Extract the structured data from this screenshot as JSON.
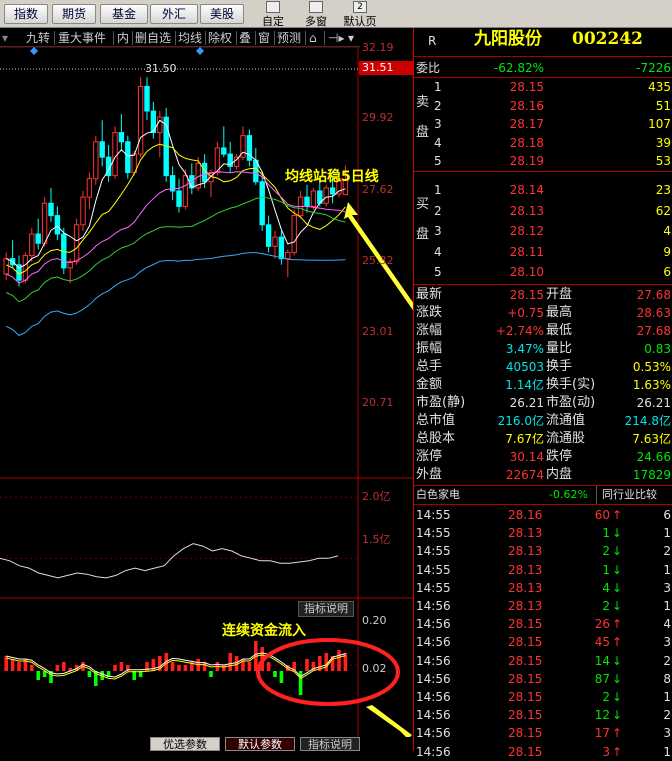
{
  "topbar": {
    "tabs": [
      "指数",
      "期货",
      "基金",
      "外汇",
      "美股"
    ],
    "right": [
      "自定",
      "多窗",
      "默认页"
    ],
    "badge": "2"
  },
  "toolbar": {
    "items": [
      "九转",
      "重大事件",
      "内",
      "删自选",
      "均线",
      "除权",
      "叠",
      "窗",
      "预测"
    ],
    "arrows": [
      "⊣▸",
      "▾"
    ]
  },
  "annotations": {
    "main": "均线站稳5日线",
    "flow": "连续资金流入"
  },
  "axis": {
    "price": [
      "32.19",
      "31.51",
      "29.92",
      "27.62",
      "25.32",
      "23.01",
      "20.71"
    ],
    "volume": [
      "2.0亿",
      "1.5亿"
    ],
    "flow": [
      "0.20",
      "0.02"
    ],
    "high_marker": "31.50"
  },
  "flow_panel": {
    "label": "指标说明"
  },
  "bottom_tabs": [
    "优选参数",
    "默认参数",
    "指标说明"
  ],
  "quote": {
    "r_label": "R",
    "name": "九阳股份",
    "code": "002242",
    "wei_label": "委比",
    "wei_ratio": "-62.82%",
    "wei_diff": "-7226",
    "sell_label": "卖盘",
    "buy_label": "买盘",
    "sell": [
      {
        "lv": "5",
        "price": "28.19",
        "vol": "53"
      },
      {
        "lv": "4",
        "price": "28.18",
        "vol": "39"
      },
      {
        "lv": "3",
        "price": "28.17",
        "vol": "107"
      },
      {
        "lv": "2",
        "price": "28.16",
        "vol": "51"
      },
      {
        "lv": "1",
        "price": "28.15",
        "vol": "435"
      }
    ],
    "buy": [
      {
        "lv": "1",
        "price": "28.14",
        "vol": "23"
      },
      {
        "lv": "2",
        "price": "28.13",
        "vol": "62"
      },
      {
        "lv": "3",
        "price": "28.12",
        "vol": "4"
      },
      {
        "lv": "4",
        "price": "28.11",
        "vol": "9"
      },
      {
        "lv": "5",
        "price": "28.10",
        "vol": "6"
      }
    ],
    "stats": [
      {
        "l1": "最新",
        "v1": "28.15",
        "c1": "red",
        "l2": "开盘",
        "v2": "27.68",
        "c2": "red"
      },
      {
        "l1": "涨跌",
        "v1": "+0.75",
        "c1": "red",
        "l2": "最高",
        "v2": "28.63",
        "c2": "red"
      },
      {
        "l1": "涨幅",
        "v1": "+2.74%",
        "c1": "red",
        "l2": "最低",
        "v2": "27.68",
        "c2": "red"
      },
      {
        "l1": "振幅",
        "v1": "3.47%",
        "c1": "cyan",
        "l2": "量比",
        "v2": "0.83",
        "c2": "grn"
      },
      {
        "l1": "总手",
        "v1": "40503",
        "c1": "cyan",
        "l2": "换手",
        "v2": "0.53%",
        "c2": "yel"
      },
      {
        "l1": "金额",
        "v1": "1.14亿",
        "c1": "cyan",
        "l2": "换手(实)",
        "v2": "1.63%",
        "c2": "yel"
      },
      {
        "l1": "市盈(静)",
        "v1": "26.21",
        "c1": "wht",
        "l2": "市盈(动)",
        "v2": "26.21",
        "c2": "wht"
      },
      {
        "l1": "总市值",
        "v1": "216.0亿",
        "c1": "cyan",
        "l2": "流通值",
        "v2": "214.8亿",
        "c2": "cyan"
      },
      {
        "l1": "总股本",
        "v1": "7.67亿",
        "c1": "yel",
        "l2": "流通股",
        "v2": "7.63亿",
        "c2": "yel"
      },
      {
        "l1": "涨停",
        "v1": "30.14",
        "c1": "red",
        "l2": "跌停",
        "v2": "24.66",
        "c2": "grn"
      },
      {
        "l1": "外盘",
        "v1": "22674",
        "c1": "red",
        "l2": "内盘",
        "v2": "17829",
        "c2": "grn"
      }
    ],
    "sector": "白色家电",
    "sector_chg": "-0.62%",
    "compare": "同行业比较",
    "ticks": [
      {
        "t": "14:55",
        "p": "28.16",
        "v": "60",
        "d": "up",
        "n": "6"
      },
      {
        "t": "14:55",
        "p": "28.13",
        "v": "1",
        "d": "dn",
        "n": "1"
      },
      {
        "t": "14:55",
        "p": "28.13",
        "v": "2",
        "d": "dn",
        "n": "2"
      },
      {
        "t": "14:55",
        "p": "28.13",
        "v": "1",
        "d": "dn",
        "n": "1"
      },
      {
        "t": "14:55",
        "p": "28.13",
        "v": "4",
        "d": "dn",
        "n": "3"
      },
      {
        "t": "14:56",
        "p": "28.13",
        "v": "2",
        "d": "dn",
        "n": "1"
      },
      {
        "t": "14:56",
        "p": "28.15",
        "v": "26",
        "d": "up",
        "n": "4"
      },
      {
        "t": "14:56",
        "p": "28.15",
        "v": "45",
        "d": "up",
        "n": "3"
      },
      {
        "t": "14:56",
        "p": "28.15",
        "v": "14",
        "d": "dn",
        "n": "2"
      },
      {
        "t": "14:56",
        "p": "28.15",
        "v": "87",
        "d": "dn",
        "n": "8"
      },
      {
        "t": "14:56",
        "p": "28.15",
        "v": "2",
        "d": "dn",
        "n": "1"
      },
      {
        "t": "14:56",
        "p": "28.15",
        "v": "12",
        "d": "dn",
        "n": "2"
      },
      {
        "t": "14:56",
        "p": "28.15",
        "v": "17",
        "d": "up",
        "n": "3"
      },
      {
        "t": "14:56",
        "p": "28.15",
        "v": "3",
        "d": "up",
        "n": "1"
      }
    ]
  },
  "chart_data": [
    {
      "type": "candlestick",
      "ylim": [
        20.71,
        32.19
      ],
      "high_marker": 31.5,
      "candles": [
        [
          25.1,
          25.8,
          24.9,
          25.6
        ],
        [
          25.6,
          26.2,
          25.3,
          25.4
        ],
        [
          25.4,
          25.7,
          24.7,
          24.9
        ],
        [
          24.9,
          25.8,
          24.8,
          25.7
        ],
        [
          25.7,
          26.6,
          25.5,
          26.4
        ],
        [
          26.4,
          26.9,
          25.9,
          26.1
        ],
        [
          26.1,
          27.6,
          26.0,
          27.4
        ],
        [
          27.4,
          27.9,
          26.8,
          27.0
        ],
        [
          27.0,
          27.3,
          26.2,
          26.4
        ],
        [
          26.4,
          26.6,
          25.1,
          25.3
        ],
        [
          25.3,
          25.6,
          24.8,
          25.5
        ],
        [
          25.5,
          26.9,
          25.4,
          26.7
        ],
        [
          26.7,
          27.8,
          26.5,
          27.6
        ],
        [
          27.6,
          28.4,
          27.2,
          28.2
        ],
        [
          28.2,
          29.6,
          28.0,
          29.4
        ],
        [
          29.4,
          30.1,
          28.6,
          28.9
        ],
        [
          28.9,
          29.3,
          28.1,
          28.3
        ],
        [
          28.3,
          29.9,
          28.2,
          29.7
        ],
        [
          29.7,
          30.3,
          29.1,
          29.4
        ],
        [
          29.4,
          29.6,
          28.2,
          28.4
        ],
        [
          28.4,
          29.1,
          28.3,
          29.0
        ],
        [
          29.0,
          31.5,
          28.9,
          31.2
        ],
        [
          31.2,
          31.5,
          30.1,
          30.4
        ],
        [
          30.4,
          30.7,
          29.5,
          29.7
        ],
        [
          29.7,
          30.4,
          28.9,
          30.2
        ],
        [
          30.2,
          30.5,
          28.1,
          28.3
        ],
        [
          28.3,
          28.6,
          27.5,
          27.8
        ],
        [
          27.8,
          28.2,
          27.1,
          27.3
        ],
        [
          27.3,
          28.5,
          27.2,
          28.3
        ],
        [
          28.3,
          28.7,
          27.7,
          27.9
        ],
        [
          27.9,
          28.9,
          27.8,
          28.7
        ],
        [
          28.7,
          29.0,
          27.9,
          28.1
        ],
        [
          28.1,
          28.5,
          27.6,
          28.4
        ],
        [
          28.4,
          29.4,
          28.3,
          29.2
        ],
        [
          29.2,
          29.9,
          28.9,
          29.0
        ],
        [
          29.0,
          29.4,
          28.4,
          28.6
        ],
        [
          28.6,
          29.0,
          28.5,
          28.9
        ],
        [
          28.9,
          29.9,
          28.8,
          29.6
        ],
        [
          29.6,
          29.8,
          28.6,
          28.8
        ],
        [
          28.8,
          29.2,
          28.0,
          28.1
        ],
        [
          28.1,
          28.4,
          26.5,
          26.7
        ],
        [
          26.7,
          27.0,
          25.8,
          26.0
        ],
        [
          26.0,
          26.5,
          25.6,
          26.3
        ],
        [
          26.3,
          26.5,
          25.4,
          25.6
        ],
        [
          25.6,
          25.9,
          25.0,
          25.8
        ],
        [
          25.8,
          27.2,
          25.7,
          27.0
        ],
        [
          27.0,
          27.8,
          26.9,
          27.6
        ],
        [
          27.6,
          28.0,
          27.1,
          27.3
        ],
        [
          27.3,
          27.9,
          27.2,
          27.8
        ],
        [
          27.8,
          28.2,
          27.3,
          27.4
        ],
        [
          27.4,
          28.0,
          27.3,
          27.9
        ],
        [
          27.9,
          28.3,
          27.4,
          27.7
        ],
        [
          27.7,
          28.3,
          27.6,
          28.2
        ],
        [
          27.68,
          28.63,
          27.68,
          28.15
        ]
      ]
    },
    {
      "type": "line",
      "ylim": [
        1.2,
        2.1
      ],
      "unit": "亿",
      "y_ticks": [
        "2.0亿",
        "1.5亿"
      ],
      "values": [
        1.5,
        1.48,
        1.44,
        1.42,
        1.38,
        1.36,
        1.34,
        1.36,
        1.38,
        1.37,
        1.35,
        1.34,
        1.36,
        1.4,
        1.42,
        1.4,
        1.42,
        1.44,
        1.52,
        1.58,
        1.62,
        1.6,
        1.56,
        1.58,
        1.56,
        1.52,
        1.5,
        1.48,
        1.48,
        1.46,
        1.46,
        1.47,
        1.48,
        1.5,
        1.5,
        1.52
      ]
    },
    {
      "type": "bar",
      "ylim": [
        -0.2,
        0.2
      ],
      "y_ticks": [
        "0.20",
        "0.02"
      ],
      "values": [
        0.05,
        0.04,
        0.03,
        0.04,
        0.02,
        -0.03,
        -0.02,
        -0.04,
        0.02,
        0.03,
        0.01,
        0.02,
        0.03,
        -0.02,
        -0.05,
        -0.03,
        -0.02,
        0.02,
        0.03,
        0.02,
        -0.03,
        -0.02,
        0.03,
        0.04,
        0.05,
        0.06,
        0.03,
        0.02,
        0.02,
        0.03,
        0.04,
        0.03,
        -0.02,
        0.03,
        0.02,
        0.06,
        0.05,
        0.04,
        0.03,
        0.1,
        0.08,
        0.03,
        -0.02,
        -0.04,
        0.02,
        0.03,
        -0.08,
        0.04,
        0.03,
        0.05,
        0.06,
        0.05,
        0.07,
        0.06
      ]
    }
  ]
}
